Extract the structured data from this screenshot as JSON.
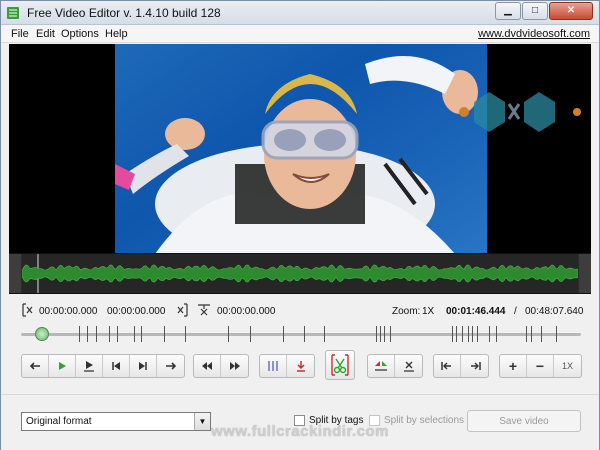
{
  "window": {
    "title": "Free Video Editor v. 1.4.10 build 128",
    "controls": [
      "minimize",
      "maximize",
      "close"
    ]
  },
  "menu": {
    "items": [
      "File",
      "Edit",
      "Options",
      "Help"
    ],
    "site_link": "www.dvdvideosoft.com"
  },
  "preview": {
    "description_icon": "video-preview"
  },
  "timeline": {
    "selection_start": "00:00:00.000",
    "selection_end": "00:00:00.000",
    "cut_time": "00:00:00.000",
    "zoom_label": "Zoom:",
    "zoom_value": "1X",
    "current_time": "00:01:46.444",
    "separator": "/",
    "total_time": "00:48:07.640",
    "position_fraction": 0.037
  },
  "toolbar": {
    "zoom_in_label": "+",
    "zoom_out_label": "−",
    "zoom_reset_label": "1X",
    "accent_color": "#2fa52f"
  },
  "bottom": {
    "format_value": "Original format",
    "split_by_tags": "Split by tags",
    "split_by_selections": "Split by selections",
    "save_label": "Save video",
    "watermark": "www.fullcrackindir.com"
  }
}
